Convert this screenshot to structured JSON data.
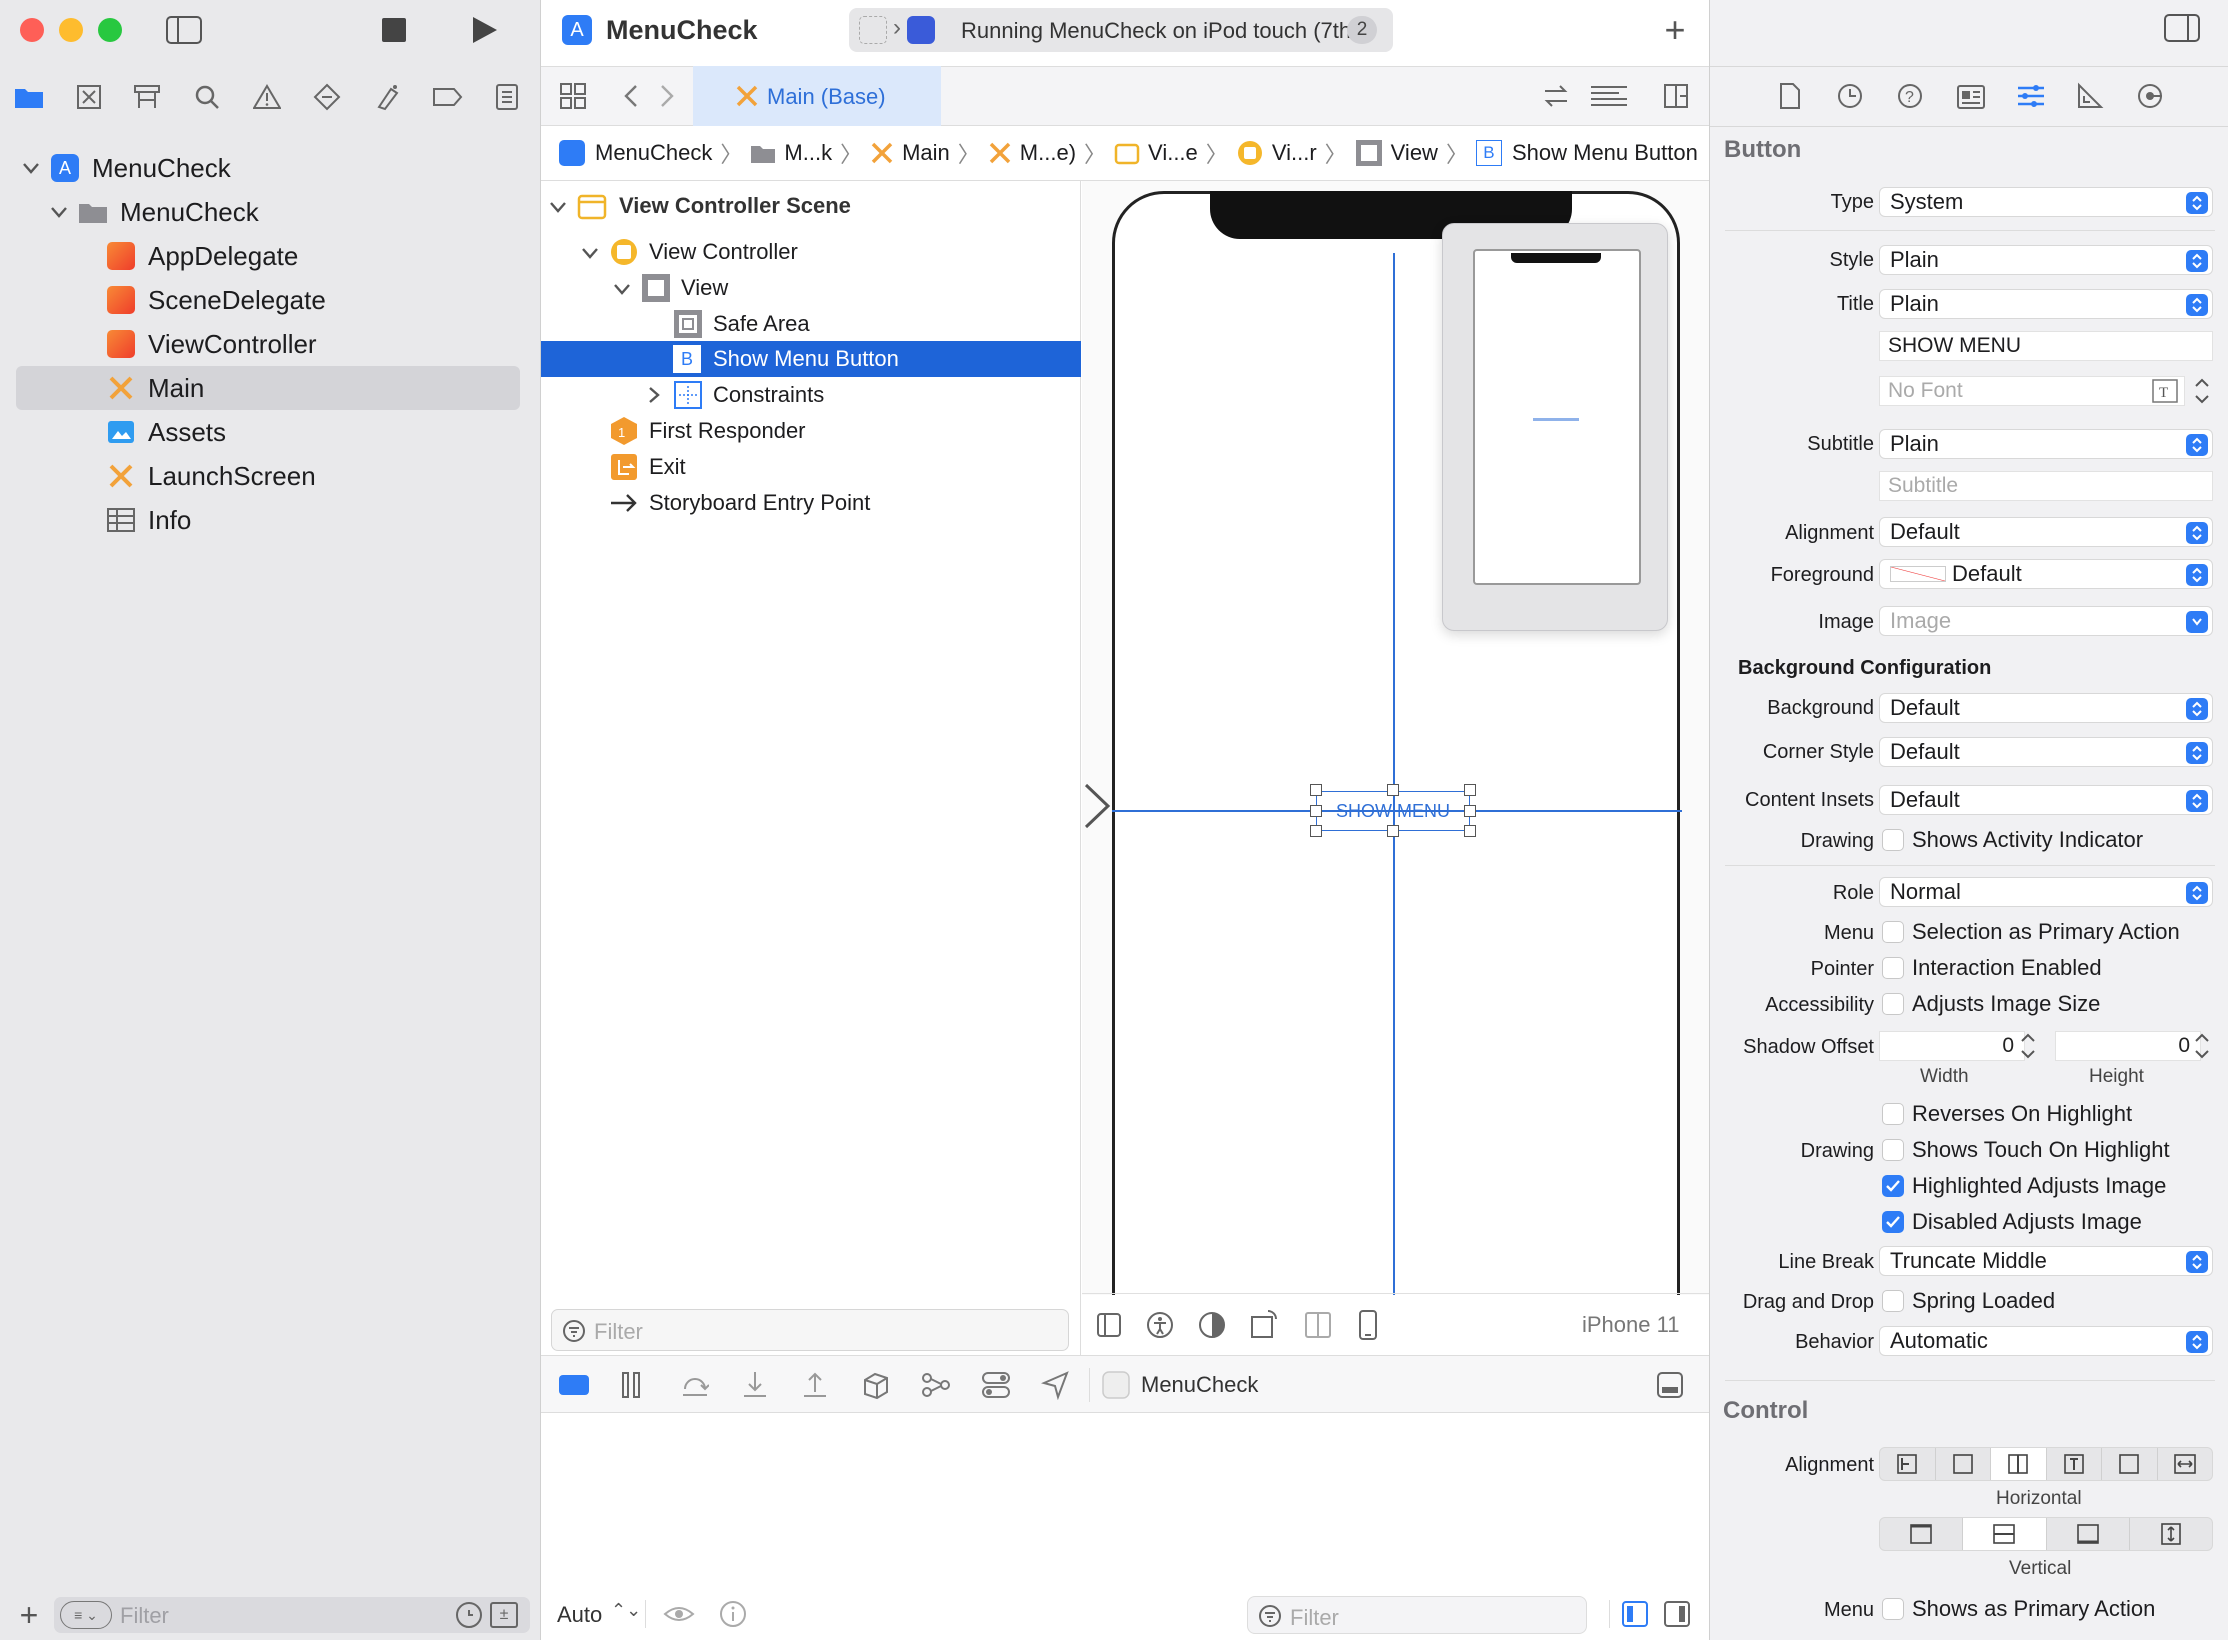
{
  "window": {
    "title": "MenuCheck"
  },
  "toolbar": {
    "status": "Running MenuCheck on iPod touch (7th...",
    "badge": "2"
  },
  "navigator": {
    "items": [
      {
        "label": "MenuCheck"
      },
      {
        "label": "MenuCheck"
      },
      {
        "label": "AppDelegate"
      },
      {
        "label": "SceneDelegate"
      },
      {
        "label": "ViewController"
      },
      {
        "label": "Main"
      },
      {
        "label": "Assets"
      },
      {
        "label": "LaunchScreen"
      },
      {
        "label": "Info"
      }
    ],
    "filter_placeholder": "Filter"
  },
  "editor": {
    "tab": "Main (Base)",
    "breadcrumb": [
      "MenuCheck",
      "M...k",
      "Main",
      "M...e)",
      "Vi...e",
      "Vi...r",
      "View",
      "Show Menu Button"
    ]
  },
  "outline": {
    "items": [
      {
        "label": "View Controller Scene"
      },
      {
        "label": "View Controller"
      },
      {
        "label": "View"
      },
      {
        "label": "Safe Area"
      },
      {
        "label": "Show Menu Button"
      },
      {
        "label": "Constraints"
      },
      {
        "label": "First Responder"
      },
      {
        "label": "Exit"
      },
      {
        "label": "Storyboard Entry Point"
      }
    ],
    "filter_placeholder": "Filter"
  },
  "canvas": {
    "button_title": "SHOW MENU",
    "device": "iPhone 11"
  },
  "debug": {
    "target": "MenuCheck",
    "auto": "Auto",
    "filter_placeholder": "Filter"
  },
  "inspector": {
    "button_header": "Button",
    "type": {
      "label": "Type",
      "value": "System"
    },
    "style": {
      "label": "Style",
      "value": "Plain"
    },
    "title": {
      "label": "Title",
      "value": "Plain",
      "text": "SHOW MENU",
      "font_placeholder": "No Font"
    },
    "subtitle": {
      "label": "Subtitle",
      "value": "Plain",
      "placeholder": "Subtitle"
    },
    "alignment": {
      "label": "Alignment",
      "value": "Default"
    },
    "foreground": {
      "label": "Foreground",
      "value": "Default"
    },
    "image": {
      "label": "Image",
      "placeholder": "Image"
    },
    "bg_config_header": "Background Configuration",
    "background": {
      "label": "Background",
      "value": "Default"
    },
    "corner_style": {
      "label": "Corner Style",
      "value": "Default"
    },
    "content_insets": {
      "label": "Content Insets",
      "value": "Default"
    },
    "drawing1": {
      "label": "Drawing",
      "option": "Shows Activity Indicator"
    },
    "role": {
      "label": "Role",
      "value": "Normal"
    },
    "menu": {
      "label": "Menu",
      "option": "Selection as Primary Action"
    },
    "pointer": {
      "label": "Pointer",
      "option": "Interaction Enabled"
    },
    "accessibility": {
      "label": "Accessibility",
      "option": "Adjusts Image Size"
    },
    "shadow_offset": {
      "label": "Shadow Offset",
      "width": "0",
      "height": "0",
      "width_label": "Width",
      "height_label": "Height"
    },
    "drawing2": {
      "label": "Drawing",
      "options": [
        "Reverses On Highlight",
        "Shows Touch On Highlight",
        "Highlighted Adjusts Image",
        "Disabled Adjusts Image"
      ]
    },
    "line_break": {
      "label": "Line Break",
      "value": "Truncate Middle"
    },
    "drag_drop": {
      "label": "Drag and Drop",
      "option": "Spring Loaded"
    },
    "behavior": {
      "label": "Behavior",
      "value": "Automatic"
    },
    "control_header": "Control",
    "ctrl_alignment": {
      "label": "Alignment",
      "horizontal": "Horizontal",
      "vertical": "Vertical"
    },
    "ctrl_menu": {
      "label": "Menu",
      "option": "Shows as Primary Action"
    }
  },
  "colors": {
    "accent": "#2e7cf6",
    "selection": "#1e64d8"
  }
}
